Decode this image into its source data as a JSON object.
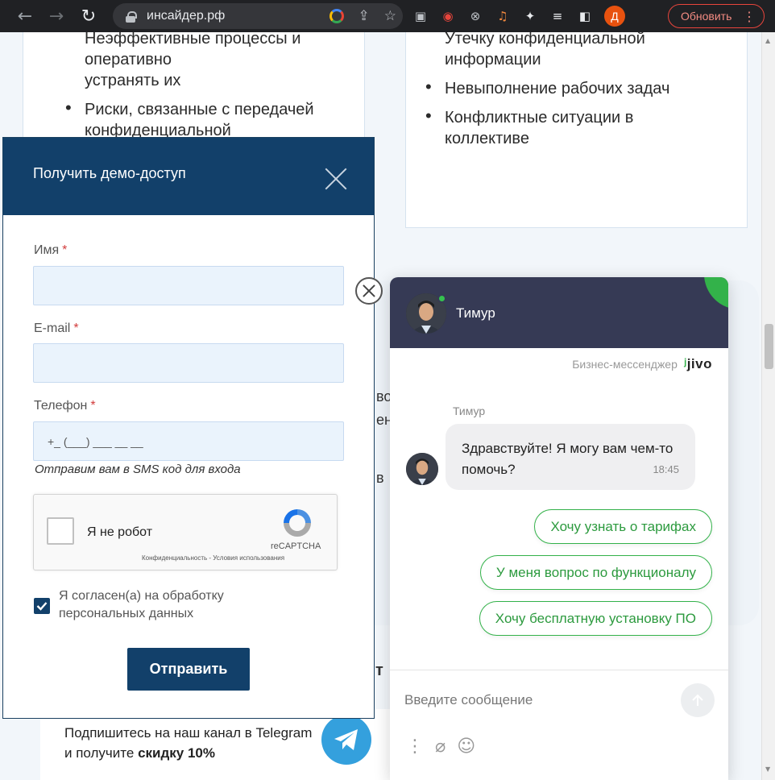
{
  "browser": {
    "url": "инсайдер.рф",
    "profile_initial": "Д",
    "update_label": "Обновить"
  },
  "page": {
    "card_left": {
      "items": [
        {
          "text": "Неэффективные процессы и",
          "bullet": false
        },
        {
          "text": "оперативно",
          "bullet": false
        },
        {
          "text": "устранять их",
          "bullet": false
        },
        {
          "text": "Риски, связанные с передачей конфиденциальной",
          "bullet": true
        }
      ]
    },
    "card_right": {
      "items": [
        {
          "text": "Утечку конфиденциальной",
          "bullet": false
        },
        {
          "text": "информации",
          "bullet": false
        },
        {
          "text": "Невыполнение рабочих задач",
          "bullet": true
        },
        {
          "text": "Конфликтные ситуации в коллективе",
          "bullet": true
        }
      ]
    },
    "background_fragments": [
      "во",
      "ен",
      "в",
      "т"
    ],
    "telegram": {
      "text_prefix": "Подпишитесь на наш канал в Telegram и получите ",
      "text_bold": "скидку 10%"
    }
  },
  "modal": {
    "title": "Получить демо-доступ",
    "name_label": "Имя",
    "email_label": "E-mail",
    "phone_label": "Телефон",
    "required_mark": "*",
    "phone_placeholder": "+_ (___) ___ __ __",
    "sms_hint": "Отправим вам в SMS код для входа",
    "captcha": {
      "label": "Я не робот",
      "brand": "reCAPTCHA",
      "links": "Конфиденциальность - Условия использования"
    },
    "consent": "Я согласен(а) на обработку персональных данных",
    "consent_checked": true,
    "submit_label": "Отправить"
  },
  "chat": {
    "agent_name": "Тимур",
    "brand_text": "Бизнес-мессенджер",
    "brand_logo": "jivo",
    "message_author": "Тимур",
    "message_text": "Здравствуйте! Я могу вам чем-то помочь?",
    "message_time": "18:45",
    "quick_replies": [
      "Хочу узнать о тарифах",
      "У меня вопрос по функционалу",
      "Хочу бесплатную установку  ПО"
    ],
    "input_placeholder": "Введите сообщение"
  },
  "colors": {
    "brand_navy": "#12406a",
    "chat_header": "#363a55",
    "jivo_green": "#33b24a",
    "telegram_blue": "#34a0dd"
  }
}
